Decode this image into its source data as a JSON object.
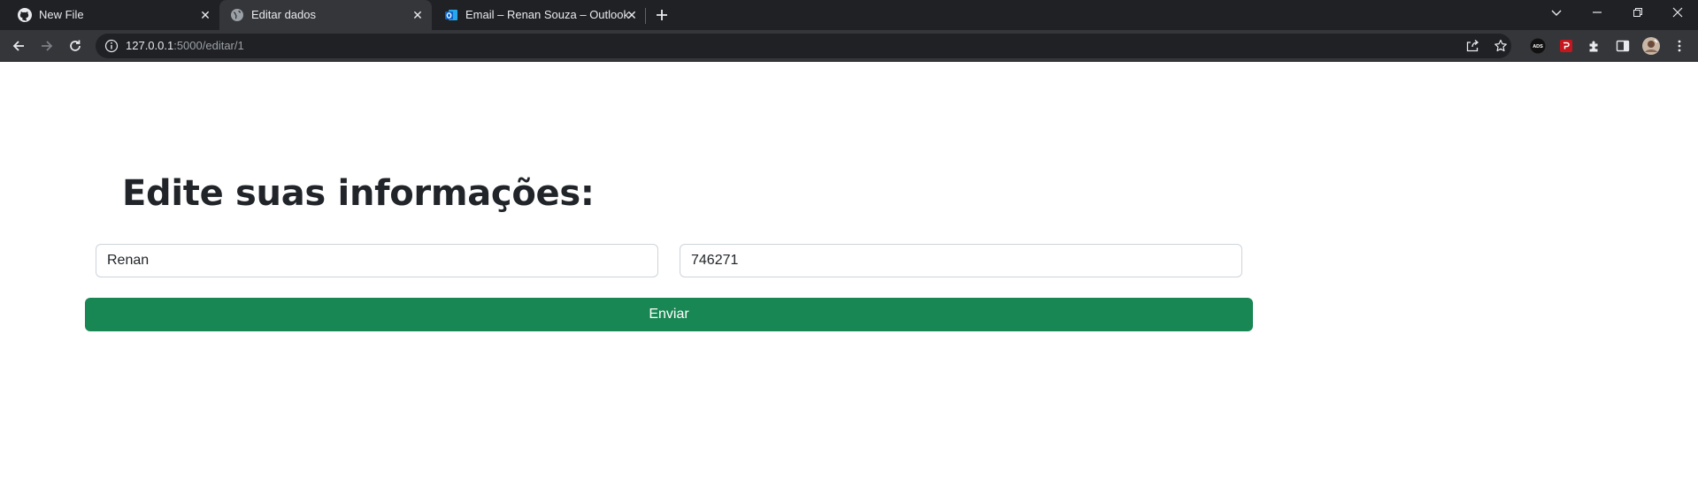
{
  "browser": {
    "tabs": [
      {
        "title": "New File",
        "icon": "github-icon",
        "active": false
      },
      {
        "title": "Editar dados",
        "icon": "globe-icon",
        "active": true
      },
      {
        "title": "Email – Renan Souza – Outlook",
        "icon": "outlook-icon",
        "active": false
      }
    ],
    "address_bar": {
      "host": "127.0.0.1",
      "path": ":5000/editar/1"
    },
    "extensions": [
      "ads-extension-icon",
      "pdf-extension-icon",
      "puzzle-icon",
      "side-panel-icon",
      "profile-avatar"
    ],
    "colors": {
      "tabstrip": "#202124",
      "toolbar": "#35363a",
      "omnibox": "#202124"
    }
  },
  "form": {
    "heading": "Edite suas informações:",
    "name_value": "Renan",
    "number_value": "746271",
    "submit_label": "Enviar",
    "submit_color": "#198754"
  }
}
